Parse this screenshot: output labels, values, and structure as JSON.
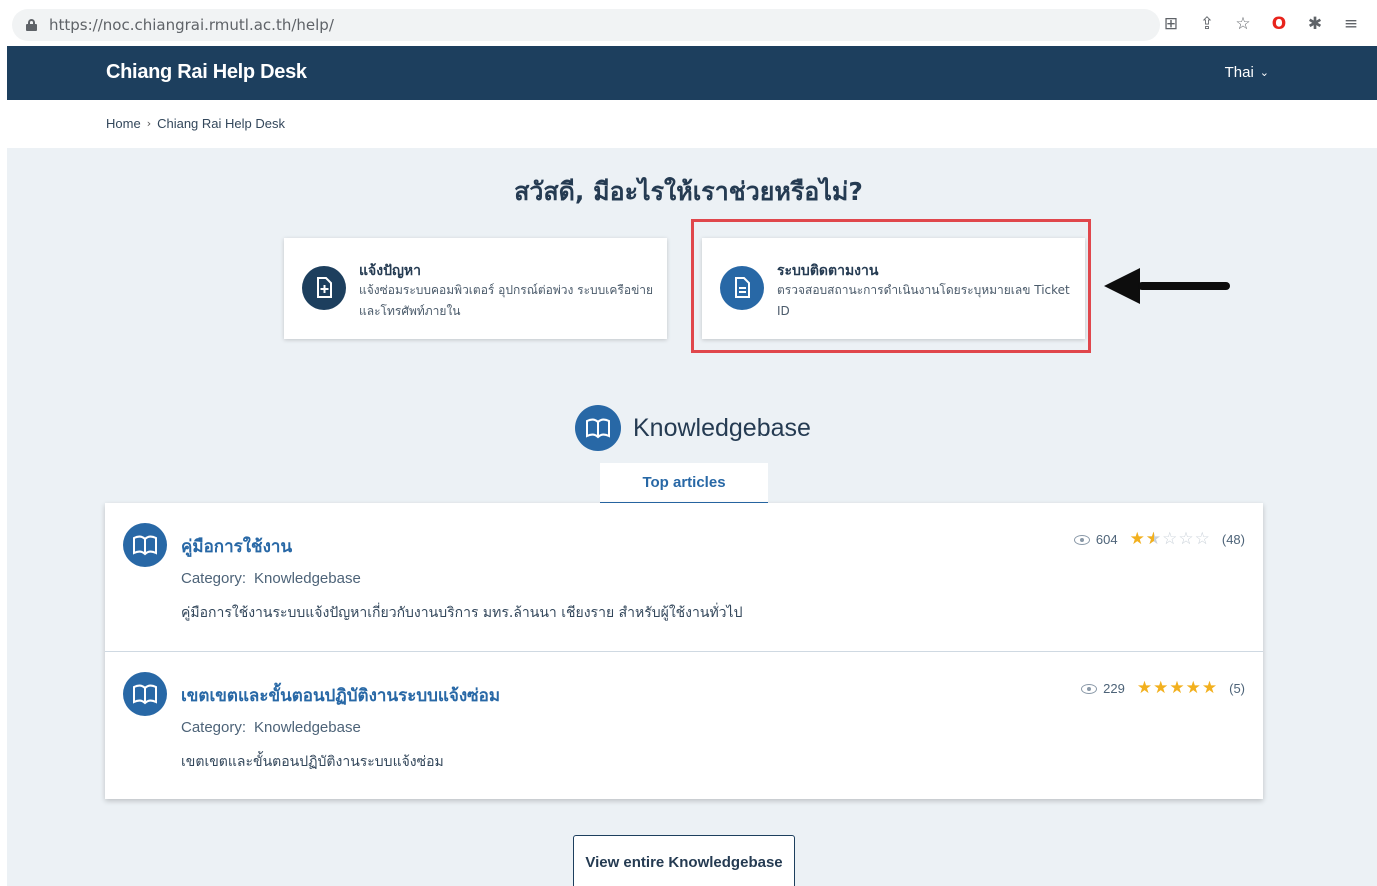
{
  "browser": {
    "url": "https://noc.chiangrai.rmutl.ac.th/help/",
    "icons": [
      "translate-icon",
      "share-icon",
      "star-icon",
      "opera-icon",
      "extensions-icon",
      "reading-list-icon"
    ]
  },
  "nav": {
    "brand": "Chiang Rai Help Desk",
    "language": "Thai",
    "color": "#1d3f5e"
  },
  "breadcrumb": {
    "home": "Home",
    "current": "Chiang Rai Help Desk"
  },
  "greeting": "สวัสดี, มีอะไรให้เราช่วยหรือไม่?",
  "cards": [
    {
      "title": "แจ้งปัญหา",
      "description": "แจ้งซ่อมระบบคอมพิวเตอร์ อุปกรณ์ต่อพ่วง ระบบเครือข่ายและโทรศัพท์ภายใน",
      "icon": "add-document-icon"
    },
    {
      "title": "ระบบติดตามงาน",
      "description": "ตรวจสอบสถานะการดำเนินงานโดยระบุหมายเลข Ticket ID",
      "icon": "document-icon"
    }
  ],
  "knowledgebase": {
    "title": "Knowledgebase",
    "tab": "Top articles",
    "category_label": "Category:",
    "articles": [
      {
        "title": "คู่มือการใช้งาน",
        "category": "Knowledgebase",
        "description": "คู่มือการใช้งานระบบแจ้งปัญหาเกี่ยวกับงานบริการ มทร.ล้านนา เชียงราย สำหรับผู้ใช้งานทั่วไป",
        "views": "604",
        "rating": 1.5,
        "votes": "(48)"
      },
      {
        "title": "เขตเขตและขั้นตอนปฏิบัติงานระบบแจ้งซ่อม",
        "category": "Knowledgebase",
        "description": "เขตเขตและขั้นตอนปฏิบัติงานระบบแจ้งซ่อม",
        "views": "229",
        "rating": 5,
        "votes": "(5)"
      }
    ],
    "view_all": "View entire Knowledgebase"
  },
  "colors": {
    "accent": "#2868a6",
    "highlight_border": "#e0474c",
    "star": "#f2b01e"
  }
}
